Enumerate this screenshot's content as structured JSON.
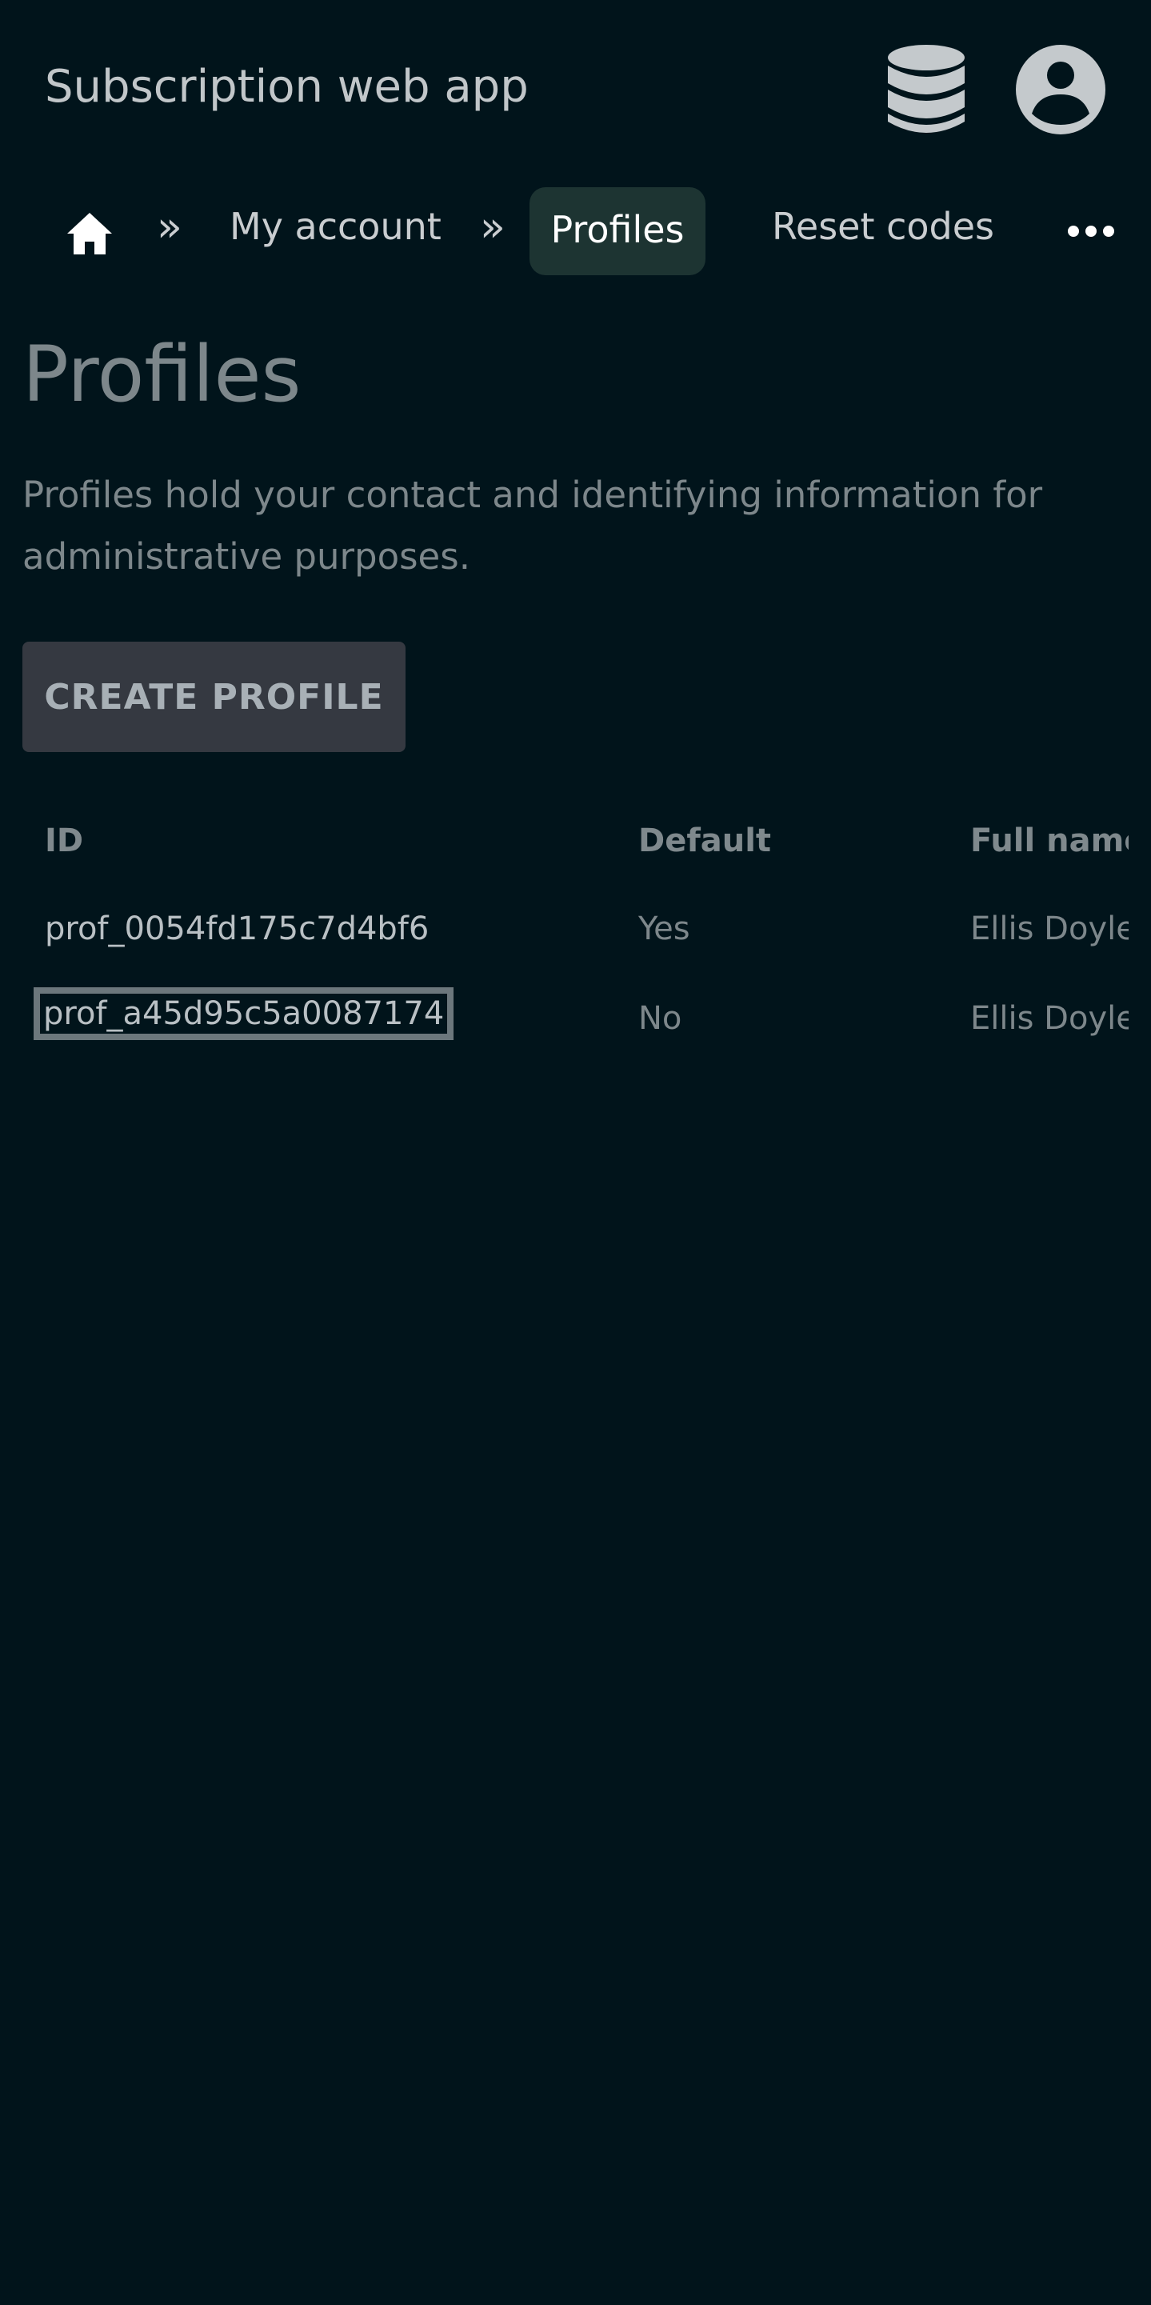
{
  "app": {
    "title": "Subscription web app",
    "icons": {
      "database": "database-icon",
      "account": "user-circle-icon"
    }
  },
  "breadcrumb": {
    "home_icon": "home-icon",
    "separator": "»",
    "items": [
      "My account",
      "Profiles",
      "Reset codes"
    ],
    "active": "Profiles",
    "more_icon": "ellipsis-icon"
  },
  "page": {
    "title": "Profiles",
    "description": "Profiles hold your contact and identifying information for administrative purposes.",
    "create_button": "CREATE PROFILE"
  },
  "table": {
    "headers": [
      "ID",
      "Default",
      "Full name"
    ],
    "rows": [
      {
        "id": "prof_0054fd175c7d4bf6",
        "default": "Yes",
        "full_name": "Ellis Doyle"
      },
      {
        "id": "prof_a45d95c5a0087174",
        "default": "No",
        "full_name": "Ellis Doyle"
      }
    ],
    "selected_row": 1
  },
  "colors": {
    "background": "#01141b",
    "active_crumb": "#1d3432",
    "button_bg": "#353941",
    "muted_text": "#7d878b"
  }
}
